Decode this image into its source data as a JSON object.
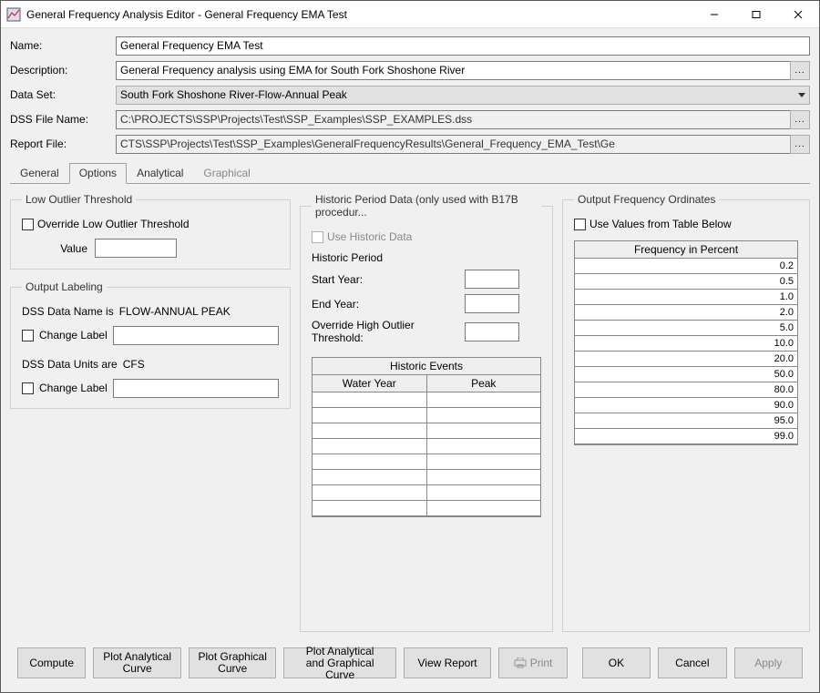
{
  "window": {
    "title": "General Frequency Analysis Editor - General Frequency EMA Test"
  },
  "form": {
    "name_label": "Name:",
    "name_value": "General Frequency EMA Test",
    "desc_label": "Description:",
    "desc_value": "General Frequency analysis using EMA for South Fork Shoshone River",
    "dataset_label": "Data Set:",
    "dataset_value": "South Fork Shoshone River-Flow-Annual Peak",
    "dssfile_label": "DSS File Name:",
    "dssfile_value": "C:\\PROJECTS\\SSP\\Projects\\Test\\SSP_Examples\\SSP_EXAMPLES.dss",
    "report_label": "Report File:",
    "report_value": "CTS\\SSP\\Projects\\Test\\SSP_Examples\\GeneralFrequencyResults\\General_Frequency_EMA_Test\\Ge",
    "dots": "..."
  },
  "tabs": {
    "t0": "General",
    "t1": "Options",
    "t2": "Analytical",
    "t3": "Graphical"
  },
  "low_outlier": {
    "legend": "Low Outlier Threshold",
    "override": "Override Low Outlier Threshold",
    "value_label": "Value"
  },
  "output_labeling": {
    "legend": "Output Labeling",
    "dataname_pre": "DSS Data Name is",
    "dataname_val": "FLOW-ANNUAL PEAK",
    "change_label": "Change Label",
    "dataunits_pre": "DSS Data Units are",
    "dataunits_val": "CFS"
  },
  "historic": {
    "legend": "Historic Period Data (only used with B17B procedur...",
    "use": "Use Historic Data",
    "period": "Historic Period",
    "start": "Start Year:",
    "end": "End Year:",
    "override_high": "Override High Outlier Threshold:",
    "events_header": "Historic Events",
    "col_wy": "Water Year",
    "col_peak": "Peak"
  },
  "freq": {
    "legend": "Output Frequency Ordinates",
    "use_below": "Use Values from Table Below",
    "header": "Frequency in Percent",
    "values": [
      "0.2",
      "0.5",
      "1.0",
      "2.0",
      "5.0",
      "10.0",
      "20.0",
      "50.0",
      "80.0",
      "90.0",
      "95.0",
      "99.0"
    ]
  },
  "footer": {
    "compute": "Compute",
    "plot_ana": "Plot Analytical\nCurve",
    "plot_gra": "Plot Graphical\nCurve",
    "plot_both": "Plot Analytical\nand Graphical Curve",
    "view": "View Report",
    "print": "Print",
    "ok": "OK",
    "cancel": "Cancel",
    "apply": "Apply"
  }
}
